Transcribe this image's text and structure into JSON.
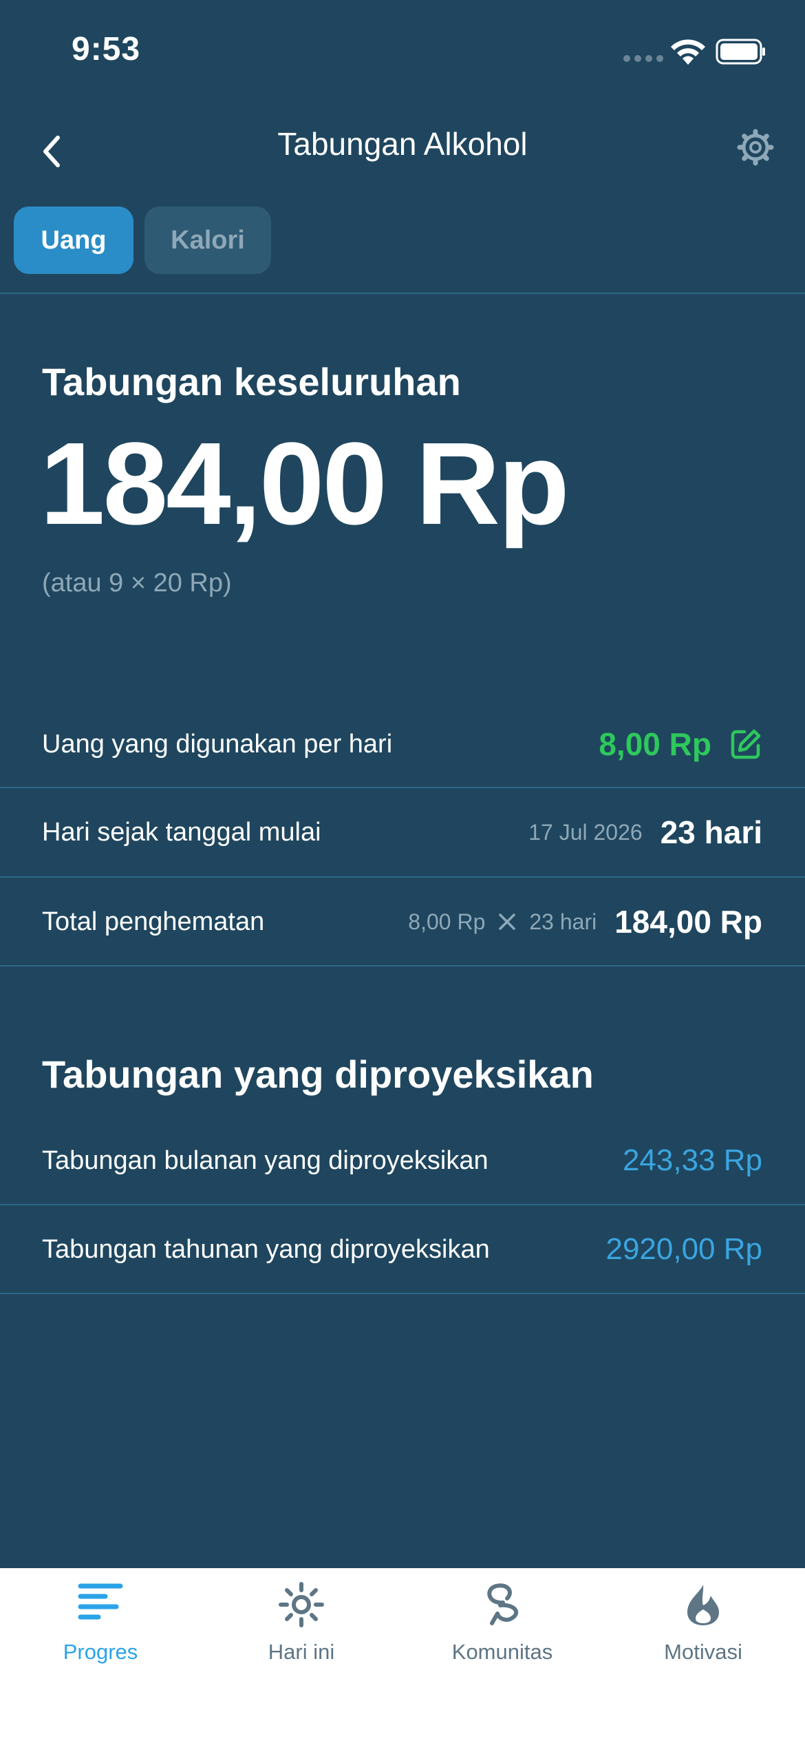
{
  "status": {
    "time": "9:53"
  },
  "nav": {
    "title": "Tabungan Alkohol"
  },
  "tabs": [
    {
      "label": "Uang"
    },
    {
      "label": "Kalori"
    }
  ],
  "overall": {
    "title": "Tabungan keseluruhan",
    "value": "184,00 Rp",
    "note": "(atau 9 × 20 Rp)"
  },
  "rows": [
    {
      "label": "Uang yang digunakan per hari",
      "value": "8,00 Rp"
    },
    {
      "label": "Hari sejak tanggal mulai",
      "meta": "17 Jul 2026",
      "value": "23 hari"
    },
    {
      "label": "Total penghematan",
      "meta_left": "8,00 Rp",
      "meta_right": "23 hari",
      "value": "184,00 Rp"
    }
  ],
  "projected": {
    "title": "Tabungan yang diproyeksikan",
    "rows": [
      {
        "label": "Tabungan bulanan yang diproyeksikan",
        "value": "243,33 Rp"
      },
      {
        "label": "Tabungan tahunan yang diproyeksikan",
        "value": "2920,00 Rp"
      }
    ]
  },
  "tabbar": [
    {
      "label": "Progres",
      "icon": "progress-icon",
      "active": true
    },
    {
      "label": "Hari ini",
      "icon": "sun-icon"
    },
    {
      "label": "Komunitas",
      "icon": "community-icon"
    },
    {
      "label": "Motivasi",
      "icon": "flame-icon"
    }
  ],
  "colors": {
    "background": "#1f465e",
    "accent": "#2aa3e8",
    "positive": "#2ec85c",
    "projection": "#3aa5e0"
  }
}
